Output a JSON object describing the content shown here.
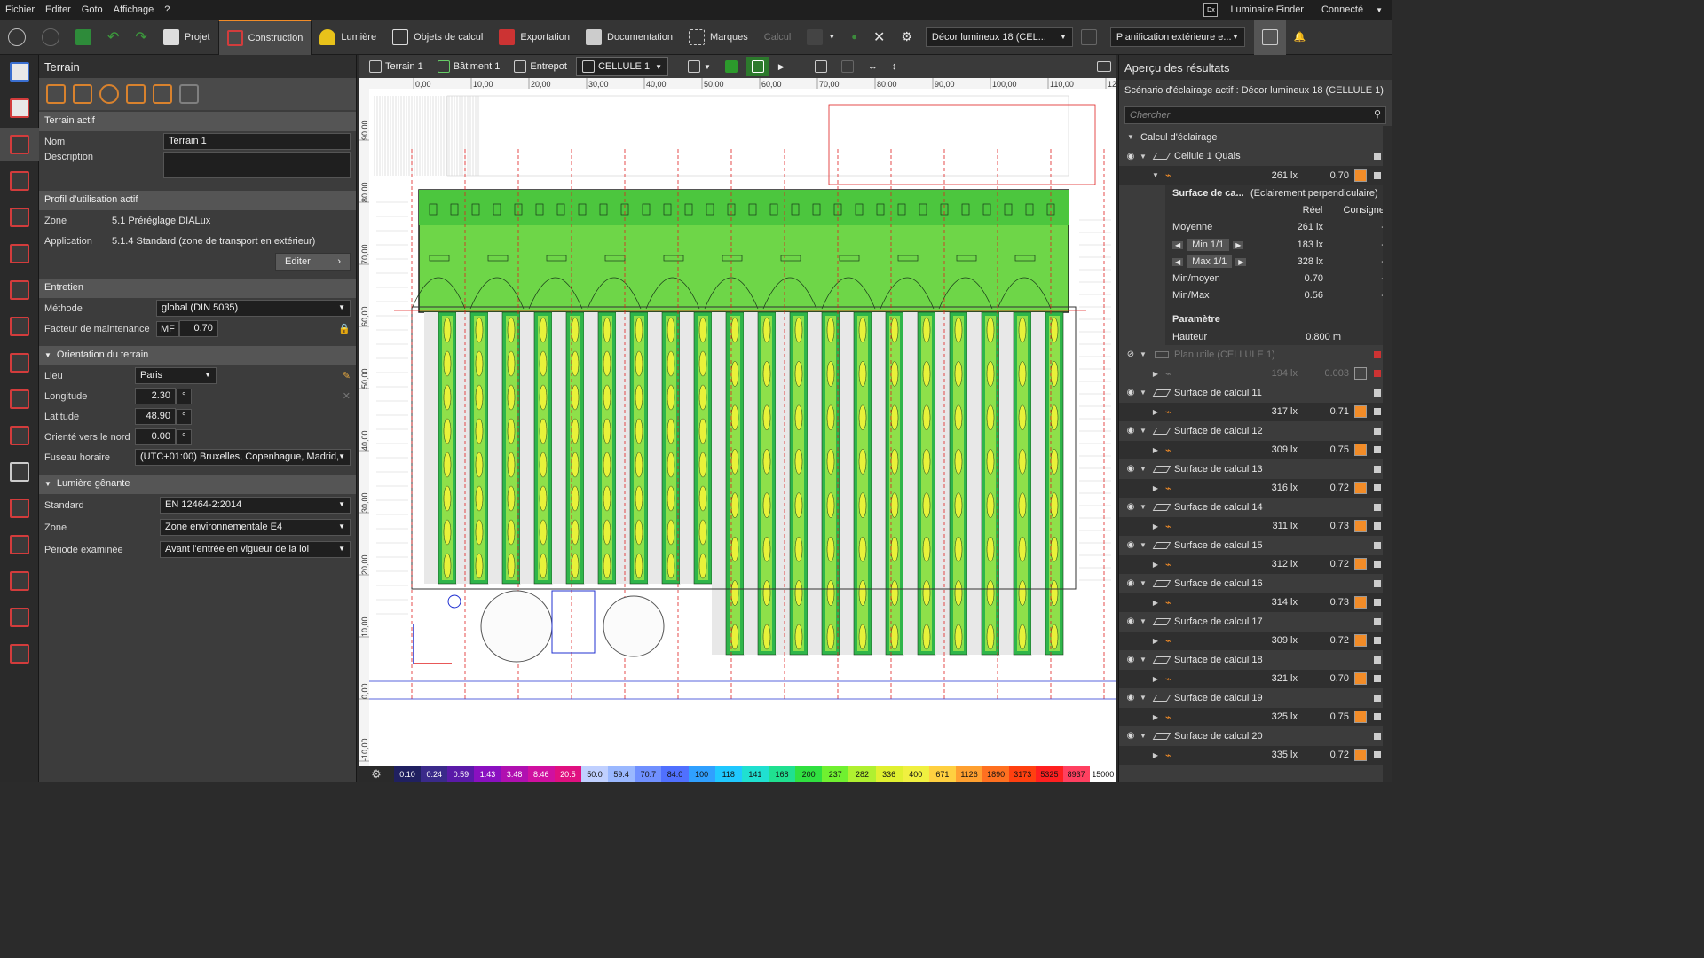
{
  "menu": [
    "Fichier",
    "Editer",
    "Goto",
    "Affichage",
    "?"
  ],
  "menu_right": {
    "finder": "Luminaire Finder",
    "connected": "Connecté",
    "dx": "Dx"
  },
  "toolbar": {
    "projet": "Projet",
    "construction": "Construction",
    "lumiere": "Lumière",
    "objets": "Objets de calcul",
    "export": "Exportation",
    "doc": "Documentation",
    "marques": "Marques",
    "calcul": "Calcul",
    "scene": "Décor lumineux 18 (CEL...",
    "plan": "Planification extérieure e..."
  },
  "left_panel": {
    "title": "Terrain",
    "active": "Terrain actif",
    "nom_lbl": "Nom",
    "nom": "Terrain 1",
    "desc_lbl": "Description",
    "profil": "Profil d'utilisation actif",
    "zone_lbl": "Zone",
    "zone": "5.1 Préréglage DIALux",
    "app_lbl": "Application",
    "app": "5.1.4 Standard (zone de transport en extérieur)",
    "edit": "Editer",
    "entretien": "Entretien",
    "meth_lbl": "Méthode",
    "meth": "global (DIN 5035)",
    "mf_lbl": "Facteur de maintenance",
    "mf": "MF",
    "mf_val": "0.70",
    "orient": "Orientation du terrain",
    "lieu_lbl": "Lieu",
    "lieu": "Paris",
    "lon_lbl": "Longitude",
    "lon": "2.30",
    "lat_lbl": "Latitude",
    "lat": "48.90",
    "nord_lbl": "Orienté vers le nord",
    "nord": "0.00",
    "deg": "°",
    "tz_lbl": "Fuseau horaire",
    "tz": "(UTC+01:00) Bruxelles, Copenhague, Madrid,",
    "glare": "Lumière gênante",
    "std_lbl": "Standard",
    "std": "EN 12464-2:2014",
    "gzone_lbl": "Zone",
    "gzone": "Zone environnementale E4",
    "per_lbl": "Période examinée",
    "per": "Avant l'entrée en vigueur de la loi"
  },
  "view_tabs": [
    "Terrain 1",
    "Bâtiment 1",
    "Entrepot",
    "CELLULE 1"
  ],
  "axis_x": [
    "0,00",
    "10,00",
    "20,00",
    "30,00",
    "40,00",
    "50,00",
    "60,00",
    "70,00",
    "80,00",
    "90,00",
    "100,00",
    "110,00",
    "120"
  ],
  "axis_y": [
    "90,00",
    "80,00",
    "70,00",
    "60,00",
    "50,00",
    "40,00",
    "30,00",
    "20,00",
    "10,00",
    "0,00",
    "-10,00"
  ],
  "legend": [
    "0.10",
    "0.24",
    "0.59",
    "1.43",
    "3.48",
    "8.46",
    "20.5",
    "50.0",
    "59.4",
    "70.7",
    "84.0",
    "100",
    "118",
    "141",
    "168",
    "200",
    "237",
    "282",
    "336",
    "400",
    "671",
    "1126",
    "1890",
    "3173",
    "5325",
    "8937",
    "15000"
  ],
  "legend_colors": [
    "#202060",
    "#3a2a8a",
    "#5a1aa8",
    "#8a10c0",
    "#b010b0",
    "#d010a0",
    "#e01080",
    "#c0d0ff",
    "#9ab8ff",
    "#7090ff",
    "#5070ff",
    "#30a0ff",
    "#20c8ff",
    "#20e0d0",
    "#20e090",
    "#30e040",
    "#70f030",
    "#b0f030",
    "#e0f030",
    "#f0f040",
    "#ffd040",
    "#ffa030",
    "#ff7020",
    "#ff4010",
    "#ff2020",
    "#ff4060",
    "#ffffff"
  ],
  "right_panel": {
    "title": "Aperçu des résultats",
    "scenario": "Scénario d'éclairage actif : Décor lumineux 18 (CELLULE 1)",
    "search": "Chercher",
    "calc": "Calcul d'éclairage",
    "cell": "Cellule 1 Quais",
    "cell_val": "261 lx",
    "cell_ratio": "0.70",
    "detail_title": "Surface de ca...",
    "detail_type": "(Eclairement perpendiculaire)",
    "reel": "Réel",
    "consigne": "Consigne",
    "rows": [
      [
        "Moyenne",
        "261 lx",
        "-"
      ],
      [
        "Min 1/1",
        "183 lx",
        "-"
      ],
      [
        "Max 1/1",
        "328 lx",
        "-"
      ],
      [
        "Min/moyen",
        "0.70",
        "-"
      ],
      [
        "Min/Max",
        "0.56",
        "-"
      ]
    ],
    "param": "Paramètre",
    "hauteur": "Hauteur",
    "hauteur_val": "0.800 m",
    "plan": "Plan utile (CELLULE 1)",
    "plan_val": "194 lx",
    "plan_ratio": "0.003",
    "surfaces": [
      [
        "Surface de calcul 11",
        "317 lx",
        "0.71"
      ],
      [
        "Surface de calcul 12",
        "309 lx",
        "0.75"
      ],
      [
        "Surface de calcul 13",
        "316 lx",
        "0.72"
      ],
      [
        "Surface de calcul 14",
        "311 lx",
        "0.73"
      ],
      [
        "Surface de calcul 15",
        "312 lx",
        "0.72"
      ],
      [
        "Surface de calcul 16",
        "314 lx",
        "0.73"
      ],
      [
        "Surface de calcul 17",
        "309 lx",
        "0.72"
      ],
      [
        "Surface de calcul 18",
        "321 lx",
        "0.70"
      ],
      [
        "Surface de calcul 19",
        "325 lx",
        "0.75"
      ],
      [
        "Surface de calcul 20",
        "335 lx",
        "0.72"
      ]
    ]
  }
}
